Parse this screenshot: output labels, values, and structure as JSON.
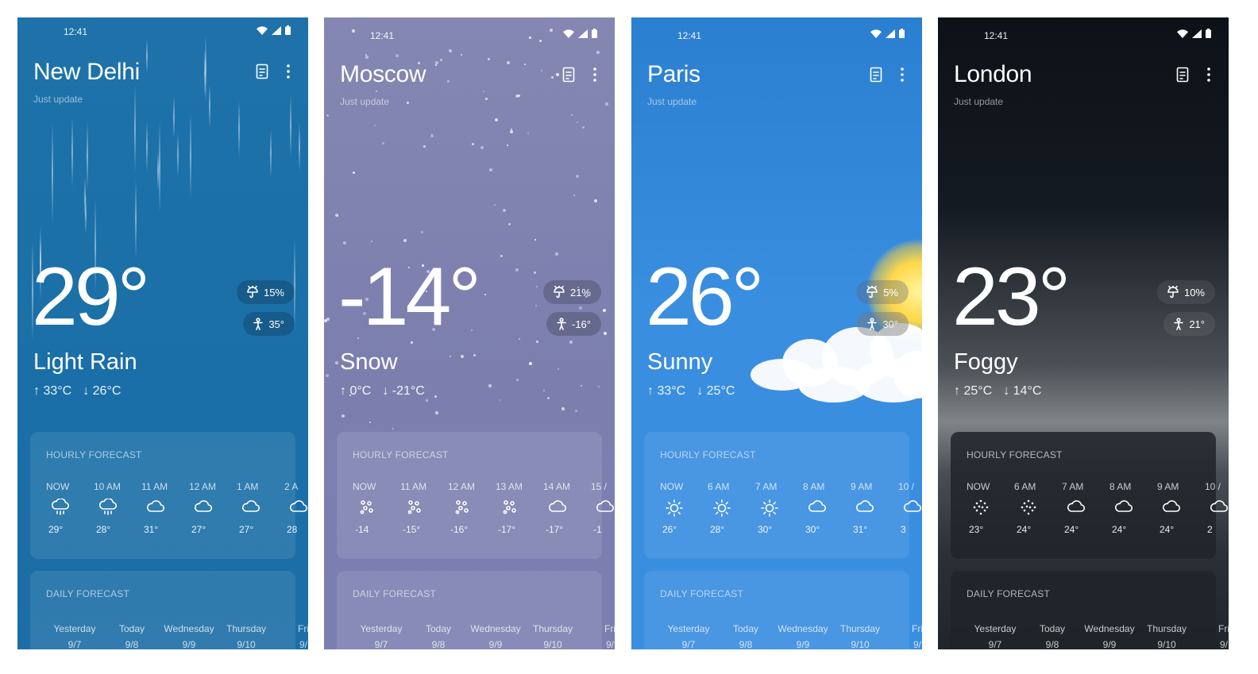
{
  "screens": [
    {
      "id": "delhi",
      "time": "12:41",
      "city": "New Delhi",
      "updated": "Just update",
      "temperature": "29°",
      "condition": "Light Rain",
      "high": "33°C",
      "low": "26°C",
      "precip": "15%",
      "feels_like": "35°",
      "hourly_title": "HOURLY FORECAST",
      "hours": [
        {
          "label": "NOW",
          "icon": "rain-icon",
          "temp": "29°"
        },
        {
          "label": "10 AM",
          "icon": "rain-icon",
          "temp": "28°"
        },
        {
          "label": "11 AM",
          "icon": "cloud-icon",
          "temp": "31°"
        },
        {
          "label": "12 AM",
          "icon": "cloud-icon",
          "temp": "27°"
        },
        {
          "label": "1 AM",
          "icon": "cloud-icon",
          "temp": "27°"
        },
        {
          "label": "2 A",
          "icon": "cloud-icon",
          "temp": "28"
        }
      ],
      "daily_title": "DAILY FORECAST",
      "days": [
        {
          "name": "Yesterday",
          "date": "9/7"
        },
        {
          "name": "Today",
          "date": "9/8"
        },
        {
          "name": "Wednesday",
          "date": "9/9"
        },
        {
          "name": "Thursday",
          "date": "9/10"
        },
        {
          "name": "Fri",
          "date": "9/"
        }
      ]
    },
    {
      "id": "moscow",
      "time": "12:41",
      "city": "Moscow",
      "updated": "Just update",
      "temperature": "-14°",
      "condition": "Snow",
      "high": "0°C",
      "low": "-21°C",
      "precip": "21%",
      "feels_like": "-16°",
      "hourly_title": "HOURLY FORECAST",
      "hours": [
        {
          "label": "NOW",
          "icon": "snow-icon",
          "temp": "-14"
        },
        {
          "label": "11 AM",
          "icon": "snow-icon",
          "temp": "-15°"
        },
        {
          "label": "12 AM",
          "icon": "snow-icon",
          "temp": "-16°"
        },
        {
          "label": "13 AM",
          "icon": "snow-icon",
          "temp": "-17°"
        },
        {
          "label": "14 AM",
          "icon": "cloud-icon",
          "temp": "-17°"
        },
        {
          "label": "15 /",
          "icon": "cloud-icon",
          "temp": "-1"
        }
      ],
      "daily_title": "DAILY FORECAST",
      "days": [
        {
          "name": "Yesterday",
          "date": "9/7"
        },
        {
          "name": "Today",
          "date": "9/8"
        },
        {
          "name": "Wednesday",
          "date": "9/9"
        },
        {
          "name": "Thursday",
          "date": "9/10"
        },
        {
          "name": "Fri",
          "date": "9/"
        }
      ]
    },
    {
      "id": "paris",
      "time": "12:41",
      "city": "Paris",
      "updated": "Just update",
      "temperature": "26°",
      "condition": "Sunny",
      "high": "33°C",
      "low": "25°C",
      "precip": "5%",
      "feels_like": "30°",
      "hourly_title": "HOURLY FORECAST",
      "hours": [
        {
          "label": "NOW",
          "icon": "sun-icon",
          "temp": "26°"
        },
        {
          "label": "6 AM",
          "icon": "sun-icon",
          "temp": "28°"
        },
        {
          "label": "7 AM",
          "icon": "sun-icon",
          "temp": "30°"
        },
        {
          "label": "8 AM",
          "icon": "cloud-icon",
          "temp": "30°"
        },
        {
          "label": "9 AM",
          "icon": "cloud-icon",
          "temp": "31°"
        },
        {
          "label": "10 /",
          "icon": "cloud-icon",
          "temp": "3"
        }
      ],
      "daily_title": "DAILY FORECAST",
      "days": [
        {
          "name": "Yesterday",
          "date": "9/7"
        },
        {
          "name": "Today",
          "date": "9/8"
        },
        {
          "name": "Wednesday",
          "date": "9/9"
        },
        {
          "name": "Thursday",
          "date": "9/10"
        },
        {
          "name": "Fri",
          "date": "9/"
        }
      ]
    },
    {
      "id": "london",
      "time": "12:41",
      "city": "London",
      "updated": "Just update",
      "temperature": "23°",
      "condition": "Foggy",
      "high": "25°C",
      "low": "14°C",
      "precip": "10%",
      "feels_like": "21°",
      "hourly_title": "HOURLY FORECAST",
      "hours": [
        {
          "label": "NOW",
          "icon": "fog-icon",
          "temp": "23°"
        },
        {
          "label": "6 AM",
          "icon": "fog-icon",
          "temp": "24°"
        },
        {
          "label": "7 AM",
          "icon": "cloud-icon",
          "temp": "24°"
        },
        {
          "label": "8 AM",
          "icon": "cloud-icon",
          "temp": "24°"
        },
        {
          "label": "9 AM",
          "icon": "cloud-icon",
          "temp": "24°"
        },
        {
          "label": "10 /",
          "icon": "cloud-icon",
          "temp": "2"
        }
      ],
      "daily_title": "DAILY FORECAST",
      "days": [
        {
          "name": "Yesterday",
          "date": "9/7"
        },
        {
          "name": "Today",
          "date": "9/8"
        },
        {
          "name": "Wednesday",
          "date": "9/9"
        },
        {
          "name": "Thursday",
          "date": "9/10"
        },
        {
          "name": "Fri",
          "date": "9/"
        }
      ]
    }
  ]
}
